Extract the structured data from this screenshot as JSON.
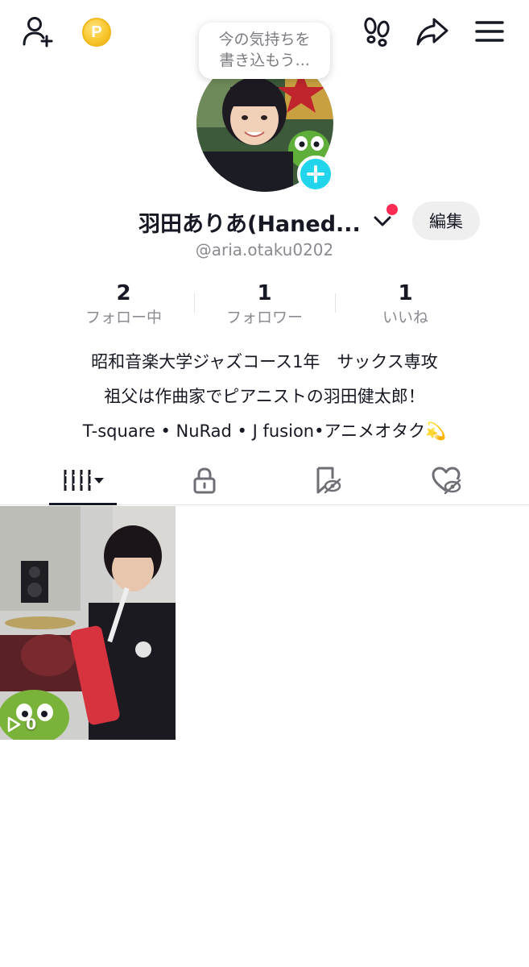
{
  "profile": {
    "display_name": "羽田ありあ(Haned...",
    "handle": "@aria.otaku0202",
    "status_bubble": [
      "今の気持ちを",
      "書き込もう..."
    ],
    "edit_label": "編集",
    "coin_letter": "P"
  },
  "stats": [
    {
      "value": "2",
      "label": "フォロー中"
    },
    {
      "value": "1",
      "label": "フォロワー"
    },
    {
      "value": "1",
      "label": "いいね"
    }
  ],
  "bio": [
    "昭和音楽大学ジャズコース1年　サックス専攻",
    "祖父は作曲家でピアニストの羽田健太郎！",
    "T-square • NuRad • J fusion•アニメオタク💫"
  ],
  "tabs": [
    {
      "icon": "grid-icon",
      "active": true
    },
    {
      "icon": "lock-icon",
      "active": false
    },
    {
      "icon": "bookmark-hidden-icon",
      "active": false
    },
    {
      "icon": "heart-hidden-icon",
      "active": false
    }
  ],
  "videos": [
    {
      "views": "0"
    }
  ],
  "colors": {
    "accent_cyan": "#20d5ec",
    "notification_red": "#fe2c55",
    "text_primary": "#161823",
    "text_secondary": "#8a8b91"
  }
}
